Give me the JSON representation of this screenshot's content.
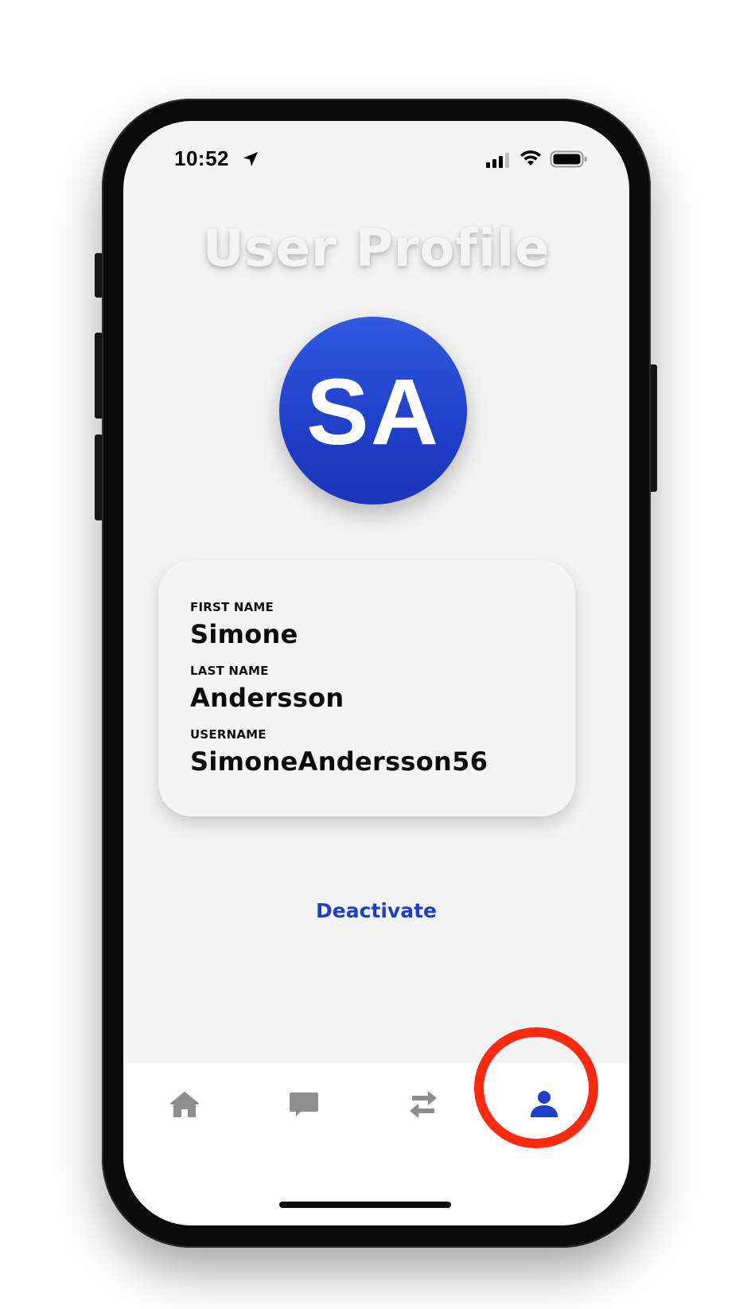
{
  "status_bar": {
    "time": "10:52",
    "icons": [
      "location-arrow-icon",
      "cellular-signal-icon",
      "wifi-icon",
      "battery-icon"
    ]
  },
  "page": {
    "title": "User Profile"
  },
  "avatar": {
    "initials": "SA",
    "color": "#2544cf"
  },
  "profile": {
    "fields": [
      {
        "label": "FIRST NAME",
        "value": "Simone"
      },
      {
        "label": "LAST NAME",
        "value": "Andersson"
      },
      {
        "label": "USERNAME",
        "value": "SimoneAndersson56"
      }
    ]
  },
  "actions": {
    "deactivate_label": "Deactivate",
    "accent_color": "#1f3fc8"
  },
  "tab_bar": {
    "tabs": [
      {
        "icon": "home-icon",
        "active": false
      },
      {
        "icon": "chat-icon",
        "active": false
      },
      {
        "icon": "transfer-arrows-icon",
        "active": false
      },
      {
        "icon": "profile-icon",
        "active": true
      }
    ],
    "inactive_color": "#8e8e8e",
    "active_color": "#1f3fc8"
  },
  "annotation": {
    "highlight_color": "#ff2a10"
  }
}
